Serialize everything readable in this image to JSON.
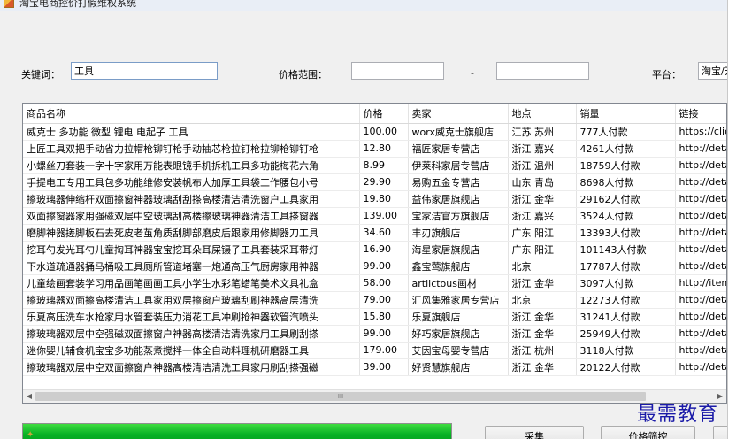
{
  "window": {
    "title": "淘宝电商控价打假维权系统"
  },
  "search": {
    "keyword_label": "关键词：",
    "keyword_value": "工具",
    "price_label": "价格范围：",
    "price_min": "",
    "price_sep": "-",
    "price_max": "",
    "platform_label": "平台：",
    "platform_value": "淘宝/天猫"
  },
  "table": {
    "columns": [
      "商品名称",
      "价格",
      "卖家",
      "地点",
      "销量",
      "链接"
    ],
    "rows": [
      [
        "威克士 多功能 微型 锂电 电起子 工具",
        "100.00",
        "worx威克士旗舰店",
        "江苏 苏州",
        "777人付款",
        "https://click.simba.taobao.com"
      ],
      [
        "上匠工具双把手动省力拉帽枪铆钉枪手动抽芯枪拉钉枪拉铆枪铆钉枪",
        "12.80",
        "福匠家居专营店",
        "浙江 嘉兴",
        "4261人付款",
        "http://detail.tmall.com"
      ],
      [
        "小螺丝刀套装一字十字家用万能表眼镜手机拆机工具多功能梅花六角",
        "8.99",
        "伊莱科家居专营店",
        "浙江 温州",
        "18759人付款",
        "http://detail.tmall.com"
      ],
      [
        "手提电工专用工具包多功能维修安装帆布大加厚工具袋工作腰包小号",
        "29.90",
        "易购五金专营店",
        "山东 青岛",
        "8698人付款",
        "http://detail.tmall.com"
      ],
      [
        "擦玻璃器伸缩杆双面擦窗神器玻璃刮刮搽高楼清洁清洗窗户工具家用",
        "19.80",
        "益伟家居旗舰店",
        "浙江 金华",
        "29162人付款",
        "http://detail.tmall.com"
      ],
      [
        "双面擦窗器家用强磁双层中空玻璃刮高楼擦玻璃神器清洁工具搽窗器",
        "139.00",
        "宝家洁官方旗舰店",
        "浙江 嘉兴",
        "3524人付款",
        "http://detail.tmall.com"
      ],
      [
        "磨脚神器搓脚板石去死皮老茧角质刮脚部磨皮后跟家用修脚器刀工具",
        "34.60",
        "丰刃旗舰店",
        "广东 阳江",
        "13393人付款",
        "http://detail.tmall.com"
      ],
      [
        "挖耳勺发光耳勺儿童掏耳神器宝宝挖耳朵耳屎镊子工具套装采耳带灯",
        "16.90",
        "海星家居旗舰店",
        "广东 阳江",
        "101143人付款",
        "http://detail.tmall.com"
      ],
      [
        "下水道疏通器捅马桶吸工具厕所管道堵塞一炮通高压气厨房家用神器",
        "99.00",
        "鑫宝莺旗舰店",
        "北京",
        "17787人付款",
        "http://detail.tmall.com"
      ],
      [
        "儿童绘画套装学习用品画笔画画工具小学生水彩笔蜡笔美术文具礼盒",
        "58.00",
        "artlictous画材",
        "浙江 金华",
        "3097人付款",
        "http://item.taobao.com"
      ],
      [
        "擦玻璃器双面擦高楼清洁工具家用双层擦窗户玻璃刮刷神器高层清洗",
        "79.00",
        "汇风集雅家居专营店",
        "北京",
        "12273人付款",
        "http://detail.tmall.com"
      ],
      [
        "乐夏高压洗车水枪家用水管套装压力消花工具冲刷抢神器软管汽喷头",
        "15.80",
        "乐夏旗舰店",
        "浙江 金华",
        "31241人付款",
        "http://detail.tmall.com"
      ],
      [
        "擦玻璃器双层中空强磁双面擦窗户神器高楼清洁清洗家用工具刷刮搽",
        "99.00",
        "好巧家居旗舰店",
        "浙江 金华",
        "25949人付款",
        "http://detail.tmall.com"
      ],
      [
        "迷你婴儿辅食机宝宝多功能蒸煮搅拌一体全自动料理机研磨器工具",
        "179.00",
        "艾因宝母婴专营店",
        "浙江 杭州",
        "3118人付款",
        "http://detail.tmall.com"
      ],
      [
        "擦玻璃器双层中空双面擦窗户神器高楼清洁清洗工具家用刷刮搽强磁",
        "39.00",
        "好贤慧旗舰店",
        "浙江 金华",
        "20122人付款",
        "http://detail.tmall.com"
      ]
    ]
  },
  "scrollbar": {
    "grip": "III"
  },
  "progress": {
    "value": 1.0
  },
  "buttons": {
    "collect": "采集",
    "price_monitor": "价格筛控"
  },
  "watermark": "最需教育",
  "colors": {
    "progress_fill": "#06b025",
    "accent": "#7a9cc7"
  }
}
